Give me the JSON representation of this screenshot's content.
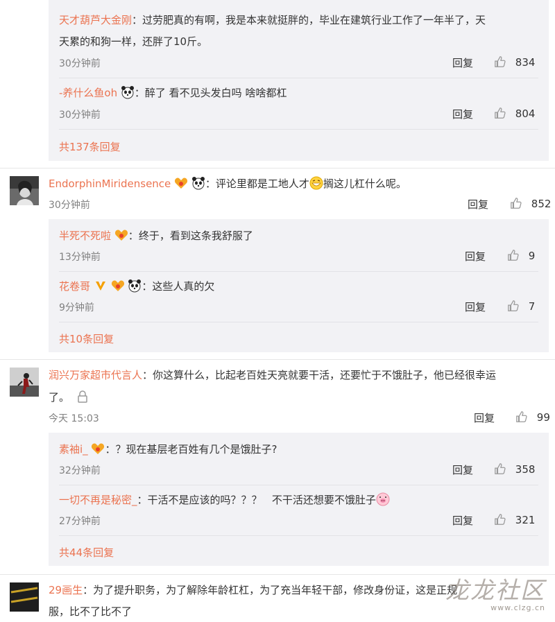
{
  "thread1": {
    "replies": [
      {
        "name": "天才葫芦大金刚",
        "text_line1": "过劳肥真的有啊，我是本来就挺胖的，毕业在建筑行业工作了一年半了，天",
        "text_line2": "天累的和狗一样，还胖了10斤。",
        "time": "30分钟前",
        "reply_label": "回复",
        "likes": "834"
      },
      {
        "name": "-养什么鱼oh",
        "text": "醉了 看不见头发白吗 啥啥都杠",
        "time": "30分钟前",
        "reply_label": "回复",
        "likes": "804"
      }
    ],
    "more": "共137条回复"
  },
  "comment2": {
    "name": "EndorphinMiridensence",
    "text_a": "评论里都是工地人才",
    "text_b": "搁这儿杠什么呢。",
    "time": "30分钟前",
    "reply_label": "回复",
    "likes": "852",
    "replies": [
      {
        "name": "半死不死啦",
        "text": "终于，看到这条我舒服了",
        "time": "13分钟前",
        "reply_label": "回复",
        "likes": "9"
      },
      {
        "name": "花卷哥",
        "text": "这些人真的欠",
        "time": "9分钟前",
        "reply_label": "回复",
        "likes": "7"
      }
    ],
    "more": "共10条回复"
  },
  "comment3": {
    "name": "润兴万家超市代言人",
    "text_line1": "你这算什么，比起老百姓天亮就要干活，还要忙于不饿肚子，他已经很幸运",
    "text_line2": "了。",
    "time": "今天 15:03",
    "reply_label": "回复",
    "likes": "99",
    "replies": [
      {
        "name": "素袖i_",
        "text": "？现在基层老百姓有几个是饿肚子?",
        "time": "32分钟前",
        "reply_label": "回复",
        "likes": "358"
      },
      {
        "name": "一切不再是秘密_",
        "text": "干活不是应该的吗？？？   不干活还想要不饿肚子",
        "time": "27分钟前",
        "reply_label": "回复",
        "likes": "321"
      }
    ],
    "more": "共44条回复"
  },
  "comment4": {
    "name": "29画生",
    "text_line1": "为了提升职务，为了解除年龄杠杠，为了充当年轻干部，修改身份证，这是正规",
    "text_line2": "服，比不了比不了"
  },
  "watermark": {
    "text": "龙龙社区",
    "url": "www.clzg.cn"
  },
  "colors": {
    "username": "#eb7350",
    "reply_bg": "#f2f2f5",
    "text": "#333333",
    "time": "#808080"
  }
}
